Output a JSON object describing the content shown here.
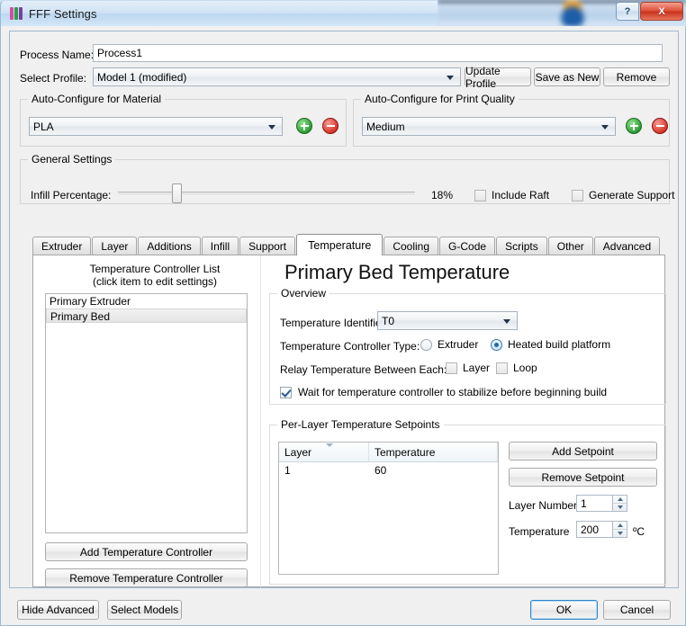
{
  "window": {
    "title": "FFF Settings",
    "icon": "fff-logo-icon",
    "help_label": "?",
    "close_label": "X"
  },
  "top": {
    "process_name_label": "Process Name:",
    "process_name_value": "Process1",
    "select_profile_label": "Select Profile:",
    "select_profile_value": "Model 1 (modified)",
    "update_profile_label": "Update Profile",
    "save_as_new_label": "Save as New",
    "remove_label": "Remove"
  },
  "material": {
    "group_title": "Auto-Configure for Material",
    "value": "PLA",
    "add_label": "+",
    "remove_label": "-"
  },
  "quality": {
    "group_title": "Auto-Configure for Print Quality",
    "value": "Medium",
    "add_label": "+",
    "remove_label": "-"
  },
  "general": {
    "group_title": "General Settings",
    "infill_label": "Infill Percentage:",
    "infill_value": "18%",
    "infill_percent": 18,
    "include_raft_label": "Include Raft",
    "include_raft_checked": false,
    "generate_support_label": "Generate Support",
    "generate_support_checked": false
  },
  "tabs": {
    "items": [
      {
        "label": "Extruder",
        "active": false
      },
      {
        "label": "Layer",
        "active": false
      },
      {
        "label": "Additions",
        "active": false
      },
      {
        "label": "Infill",
        "active": false
      },
      {
        "label": "Support",
        "active": false
      },
      {
        "label": "Temperature",
        "active": true
      },
      {
        "label": "Cooling",
        "active": false
      },
      {
        "label": "G-Code",
        "active": false
      },
      {
        "label": "Scripts",
        "active": false
      },
      {
        "label": "Other",
        "active": false
      },
      {
        "label": "Advanced",
        "active": false
      }
    ]
  },
  "controller_list": {
    "title_line1": "Temperature Controller List",
    "title_line2": "(click item to edit settings)",
    "items": [
      {
        "label": "Primary Extruder",
        "selected": false
      },
      {
        "label": "Primary Bed",
        "selected": true
      }
    ],
    "add_label": "Add Temperature Controller",
    "remove_label": "Remove Temperature Controller"
  },
  "panel": {
    "heading": "Primary Bed Temperature"
  },
  "overview": {
    "group_title": "Overview",
    "identifier_label": "Temperature Identifier",
    "identifier_value": "T0",
    "controller_type_label": "Temperature Controller Type:",
    "type_extruder_label": "Extruder",
    "type_extruder_selected": false,
    "type_bed_label": "Heated build platform",
    "type_bed_selected": true,
    "relay_label": "Relay Temperature Between Each:",
    "relay_layer_label": "Layer",
    "relay_layer_checked": false,
    "relay_loop_label": "Loop",
    "relay_loop_checked": false,
    "wait_label": "Wait for temperature controller to stabilize before beginning build",
    "wait_checked": true
  },
  "setpoints": {
    "group_title": "Per-Layer Temperature Setpoints",
    "columns": [
      "Layer",
      "Temperature"
    ],
    "rows": [
      [
        "1",
        "60"
      ]
    ],
    "add_label": "Add Setpoint",
    "remove_label": "Remove Setpoint",
    "layer_number_label": "Layer Number",
    "layer_number_value": "1",
    "temperature_label": "Temperature",
    "temperature_value": "200",
    "unit_label": "ºC"
  },
  "footer": {
    "hide_advanced_label": "Hide Advanced",
    "select_models_label": "Select Models",
    "ok_label": "OK",
    "cancel_label": "Cancel"
  },
  "colors": {
    "accent": "#2e86c8",
    "close_red": "#d8352a",
    "add_green": "#2f9d35",
    "title_blue": "#cfe2f4"
  }
}
